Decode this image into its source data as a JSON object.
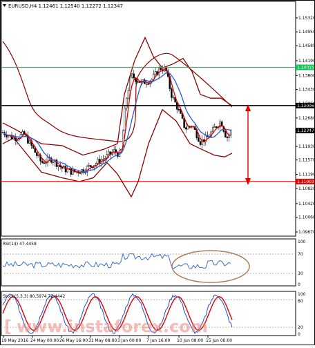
{
  "header": {
    "symbol_line": "EURUSD,H4 1.12461 1.12540 1.12272 1.12347"
  },
  "price_axis": {
    "labels": [
      "1.15320",
      "1.14950",
      "1.14585",
      "1.14190",
      "1.13800",
      "1.13430",
      "1.13060",
      "1.12680",
      "1.12310",
      "1.11930",
      "1.11570",
      "1.11190",
      "1.10820",
      "1.10420",
      "1.10060",
      "1.09670"
    ],
    "range": [
      1.0967,
      1.155
    ]
  },
  "levels": [
    {
      "name": "resistance-green",
      "value": 1.14015,
      "label": "1.14015",
      "color": "#1bbf5a"
    },
    {
      "name": "black-level",
      "value": 1.13006,
      "label": "1.13006",
      "color": "#000000"
    },
    {
      "name": "current-price",
      "value": 1.12347,
      "label": "1.12347",
      "color": "#000000"
    },
    {
      "name": "support-red",
      "value": 1.11003,
      "label": "1.11003",
      "color": "#e00000"
    }
  ],
  "date_axis": {
    "labels": [
      "19 May 2016",
      "24 May 00:00",
      "26 May 16:00",
      "31 May 08:00",
      "3 Jun 00:00",
      "7 Jun 16:00",
      "10 Jun 08:00",
      "15 Jun 00:00"
    ]
  },
  "rsi": {
    "label": "RSI(14) 47.4458",
    "axis_labels": [
      "100",
      "70",
      "30",
      "0"
    ]
  },
  "stoch": {
    "label": "Stoch(5,3,3) 80.5974 72.4442",
    "axis_labels": [
      "100",
      "80",
      "20",
      "0"
    ]
  },
  "watermark": {
    "text": "www.instaforex.com"
  },
  "colors": {
    "bollinger": "#8b0000",
    "ma_fast": "#e00000",
    "ma_slow": "#2a5bd7",
    "rsi_line": "#3a6ed0",
    "stoch_main": "#1f4fd8",
    "stoch_signal": "#e00000",
    "annotation_ellipse": "#b07a55",
    "arrow": "#e00000"
  }
}
